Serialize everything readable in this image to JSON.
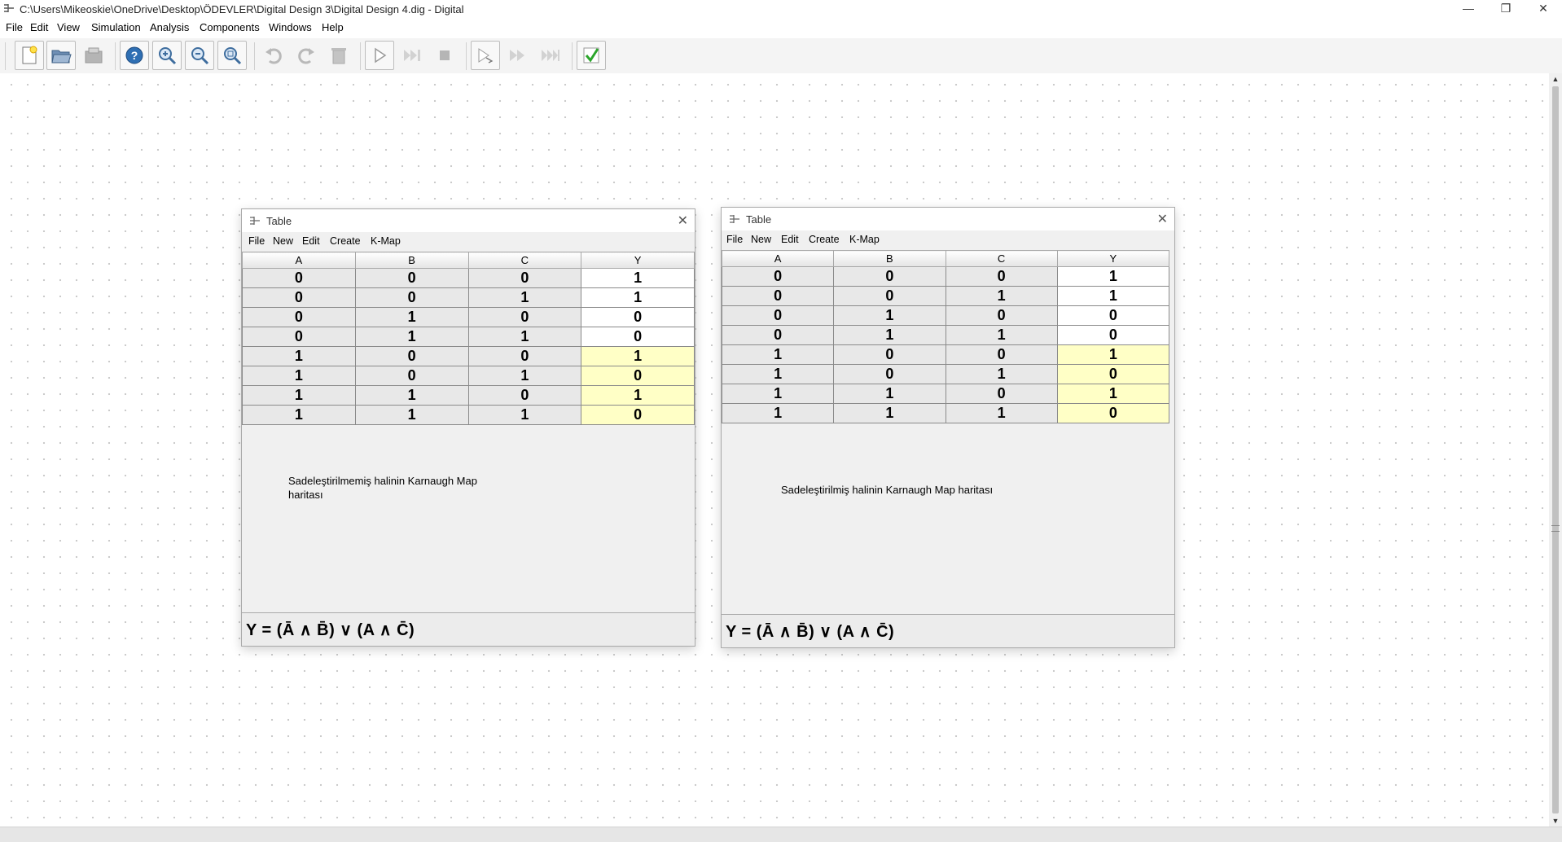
{
  "window": {
    "title": "C:\\Users\\Mikeoskie\\OneDrive\\Desktop\\ÖDEVLER\\Digital Design 3\\Digital Design 4.dig - Digital",
    "minimize_glyph": "—",
    "maximize_glyph": "❐",
    "close_glyph": "✕"
  },
  "menu": [
    "File",
    "Edit",
    "View",
    "Simulation",
    "Analysis",
    "Components",
    "Windows",
    "Help"
  ],
  "toolbar": {
    "icons": [
      "new-file-icon",
      "open-folder-icon",
      "save-icon",
      "help-icon",
      "zoom-in-icon",
      "zoom-out-icon",
      "fit-zoom-icon",
      "undo-icon",
      "redo-icon",
      "delete-icon",
      "start-simulation-icon",
      "fast-run-icon",
      "stop-icon",
      "step-icon",
      "run-to-break-icon",
      "run-to-end-icon",
      "check-icon"
    ]
  },
  "dialogs": [
    {
      "title": "Table",
      "menu": [
        "File",
        "New",
        "Edit",
        "Create",
        "K-Map"
      ],
      "headers": [
        "A",
        "B",
        "C",
        "Y"
      ],
      "rows": [
        [
          "0",
          "0",
          "0",
          "1"
        ],
        [
          "0",
          "0",
          "1",
          "1"
        ],
        [
          "0",
          "1",
          "0",
          "0"
        ],
        [
          "0",
          "1",
          "1",
          "0"
        ],
        [
          "1",
          "0",
          "0",
          "1"
        ],
        [
          "1",
          "0",
          "1",
          "0"
        ],
        [
          "1",
          "1",
          "0",
          "1"
        ],
        [
          "1",
          "1",
          "1",
          "0"
        ]
      ],
      "note_lines": [
        "Sadeleştirilmemiş halinin Karnaugh Map",
        "haritası"
      ],
      "expression": "Y = (Ā ∧ B̄) ∨ (A ∧ C̄)"
    },
    {
      "title": "Table",
      "menu": [
        "File",
        "New",
        "Edit",
        "Create",
        "K-Map"
      ],
      "headers": [
        "A",
        "B",
        "C",
        "Y"
      ],
      "rows": [
        [
          "0",
          "0",
          "0",
          "1"
        ],
        [
          "0",
          "0",
          "1",
          "1"
        ],
        [
          "0",
          "1",
          "0",
          "0"
        ],
        [
          "0",
          "1",
          "1",
          "0"
        ],
        [
          "1",
          "0",
          "0",
          "1"
        ],
        [
          "1",
          "0",
          "1",
          "0"
        ],
        [
          "1",
          "1",
          "0",
          "1"
        ],
        [
          "1",
          "1",
          "1",
          "0"
        ]
      ],
      "note_lines": [
        "Sadeleştirilmiş halinin Karnaugh Map haritası"
      ],
      "expression": "Y = (Ā ∧ B̄) ∨ (A ∧ C̄)"
    }
  ],
  "colors": {
    "highlight_cell": "#ffffc6",
    "input_cell": "#e8e8e8",
    "canvas_dot": "#c8c8c8"
  }
}
